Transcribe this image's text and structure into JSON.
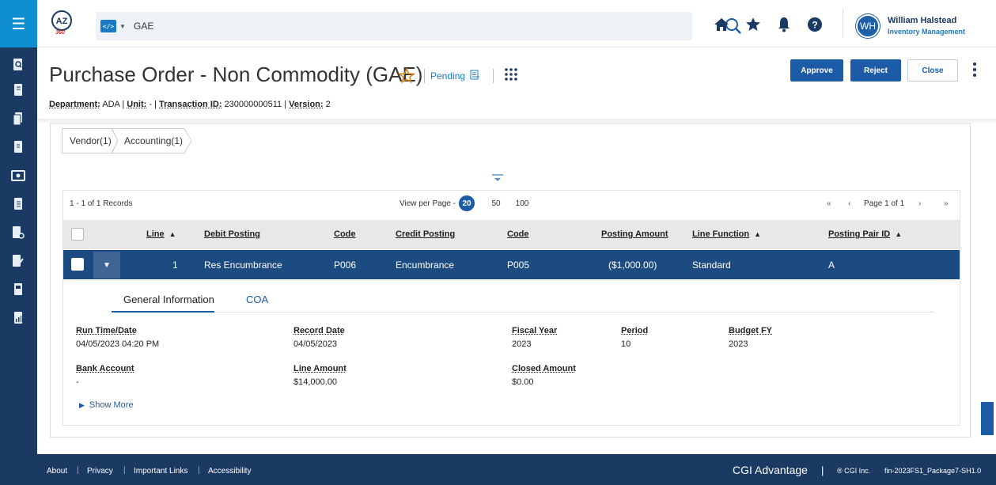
{
  "header": {
    "scope_label": "</>",
    "search_value": "GAE",
    "user_name": "William Halstead",
    "user_role": "Inventory Management",
    "avatar_initials": "WH"
  },
  "page": {
    "title": "Purchase Order - Non Commodity (GAE)",
    "status": "Pending",
    "meta": {
      "department_label": "Department:",
      "department_value": "ADA",
      "unit_label": "Unit:",
      "unit_value": "-",
      "txn_label": "Transaction ID:",
      "txn_value": "230000000511",
      "version_label": "Version:",
      "version_value": "2",
      "sep": "|"
    },
    "actions": {
      "approve": "Approve",
      "reject": "Reject",
      "close": "Close"
    }
  },
  "breadcrumbs": [
    "Vendor(1)",
    "Accounting(1)"
  ],
  "grid": {
    "records": "1 - 1 of 1 Records",
    "view_per_page": "View per Page -",
    "page_sizes": [
      "20",
      "50",
      "100"
    ],
    "page_label": "Page 1 of 1",
    "columns": {
      "line": "Line",
      "debit_posting": "Debit Posting",
      "code1": "Code",
      "credit_posting": "Credit Posting",
      "code2": "Code",
      "posting_amount": "Posting Amount",
      "line_function": "Line Function",
      "posting_pair_id": "Posting Pair ID"
    },
    "row": {
      "line": "1",
      "debit_posting": "Res Encumbrance",
      "code1": "P006",
      "credit_posting": "Encumbrance",
      "code2": "P005",
      "posting_amount": "($1,000.00)",
      "line_function": "Standard",
      "posting_pair_id": "A"
    }
  },
  "detail": {
    "tabs": [
      "General Information",
      "COA"
    ],
    "fields": {
      "run_time_label": "Run Time/Date",
      "run_time_value": "04/05/2023 04:20 PM",
      "record_date_label": "Record Date",
      "record_date_value": "04/05/2023",
      "fiscal_year_label": "Fiscal Year",
      "fiscal_year_value": "2023",
      "period_label": "Period",
      "period_value": "10",
      "budget_fy_label": "Budget FY",
      "budget_fy_value": "2023",
      "bank_account_label": "Bank Account",
      "bank_account_value": "-",
      "line_amount_label": "Line Amount",
      "line_amount_value": "$14,000.00",
      "closed_amount_label": "Closed Amount",
      "closed_amount_value": "$0.00"
    },
    "show_more": "Show More"
  },
  "footer": {
    "links": [
      "About",
      "Privacy",
      "Important Links",
      "Accessibility"
    ],
    "sep": "|",
    "brand": "CGI Advantage",
    "brand_sep": "|",
    "copyright": "® CGI Inc.",
    "build": "fin-2023FS1_Package7-SH1.0"
  },
  "colors": {
    "rail": "#1a3a63",
    "accent": "#0f8fd1",
    "primary_button": "#1c5ca6",
    "selected_row": "#1c4b82",
    "star": "#e08a1e"
  }
}
